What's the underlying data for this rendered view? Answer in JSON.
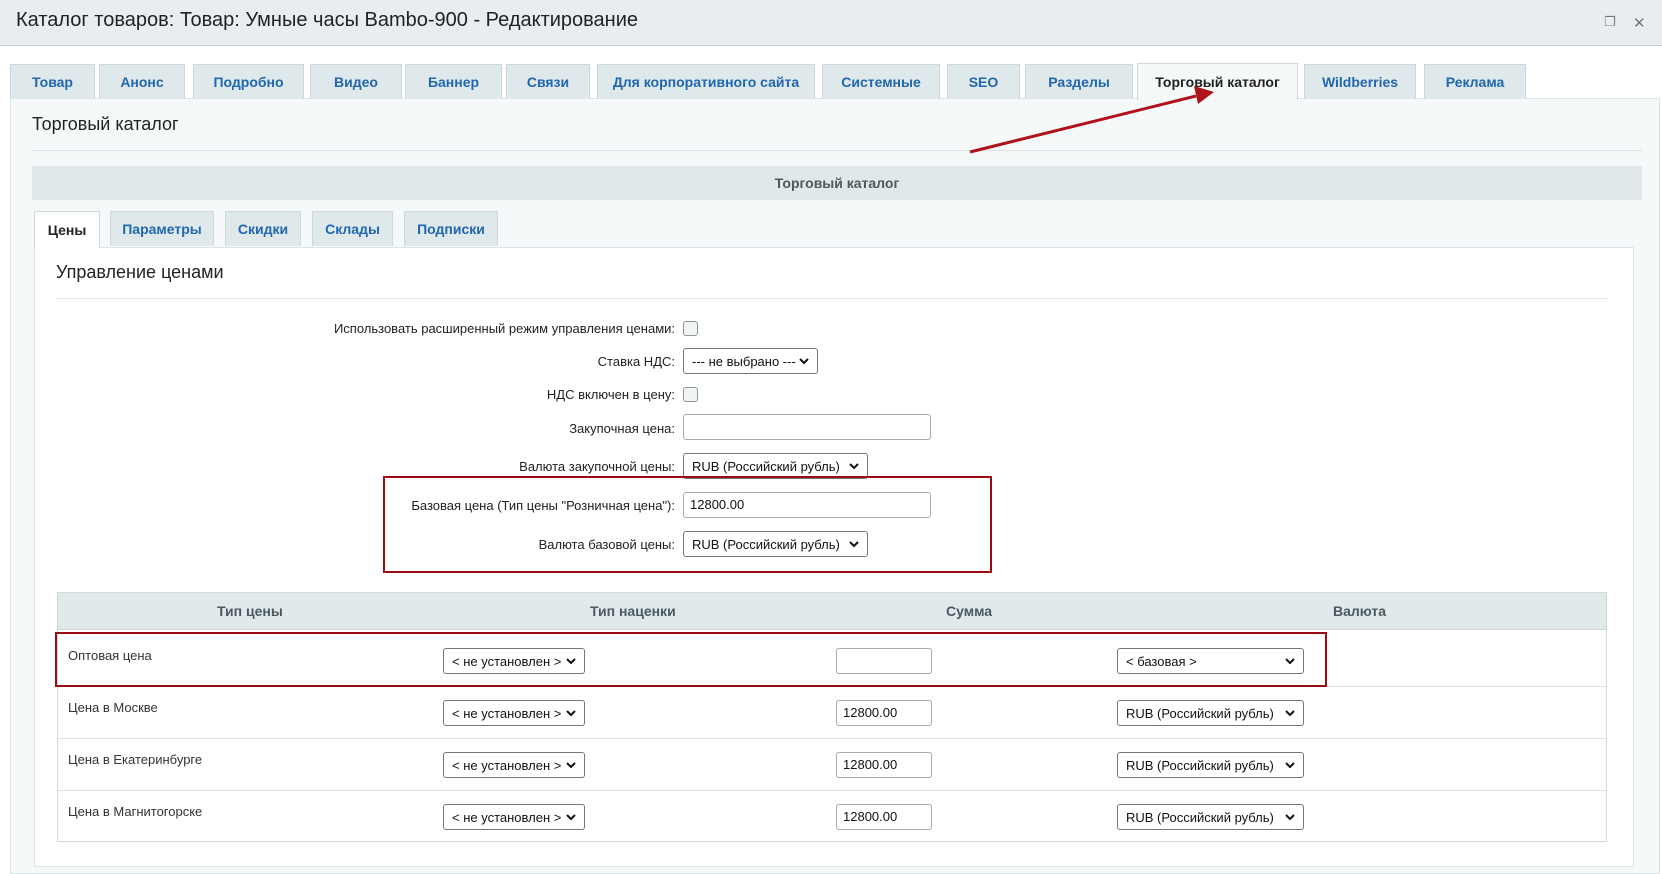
{
  "window": {
    "title": "Каталог товаров: Товар: Умные часы Bambo-900 - Редактирование"
  },
  "main_tabs": [
    {
      "label": "Товар"
    },
    {
      "label": "Анонс"
    },
    {
      "label": "Подробно"
    },
    {
      "label": "Видео"
    },
    {
      "label": "Баннер"
    },
    {
      "label": "Связи"
    },
    {
      "label": "Для корпоративного сайта"
    },
    {
      "label": "Системные"
    },
    {
      "label": "SEO"
    },
    {
      "label": "Разделы"
    },
    {
      "label": "Торговый каталог",
      "active": true
    },
    {
      "label": "Wildberries"
    },
    {
      "label": "Реклама"
    }
  ],
  "section": {
    "title": "Торговый каталог",
    "bar_title": "Торговый каталог"
  },
  "sub_tabs": [
    {
      "label": "Цены",
      "active": true
    },
    {
      "label": "Параметры"
    },
    {
      "label": "Скидки"
    },
    {
      "label": "Склады"
    },
    {
      "label": "Подписки"
    }
  ],
  "prices": {
    "title": "Управление ценами",
    "extended_mode_label": "Использовать расширенный режим управления ценами:",
    "extended_mode_checked": false,
    "vat_rate_label": "Ставка НДС:",
    "vat_rate_value": "--- не выбрано ---",
    "vat_included_label": "НДС включен в цену:",
    "vat_included_checked": false,
    "purchase_price_label": "Закупочная цена:",
    "purchase_price_value": "",
    "purchase_currency_label": "Валюта закупочной цены:",
    "purchase_currency_value": "RUB (Российский рубль)",
    "base_price_label": "Базовая цена (Тип цены \"Розничная цена\"):",
    "base_price_value": "12800.00",
    "base_currency_label": "Валюта базовой цены:",
    "base_currency_value": "RUB (Российский рубль)"
  },
  "price_table": {
    "headers": [
      "Тип цены",
      "Тип наценки",
      "Сумма",
      "Валюта"
    ],
    "rows": [
      {
        "type": "Оптовая цена",
        "markup": "< не установлен >",
        "amount": "",
        "currency": "< базовая >"
      },
      {
        "type": "Цена в Москве",
        "markup": "< не установлен >",
        "amount": "12800.00",
        "currency": "RUB (Российский рубль)"
      },
      {
        "type": "Цена в Екатеринбурге",
        "markup": "< не установлен >",
        "amount": "12800.00",
        "currency": "RUB (Российский рубль)"
      },
      {
        "type": "Цена в Магнитогорске",
        "markup": "< не установлен >",
        "amount": "12800.00",
        "currency": "RUB (Российский рубль)"
      }
    ]
  },
  "colors": {
    "tab_text": "#2067b0",
    "highlight": "#9c0a14",
    "bar_bg": "#e0e8ea"
  }
}
